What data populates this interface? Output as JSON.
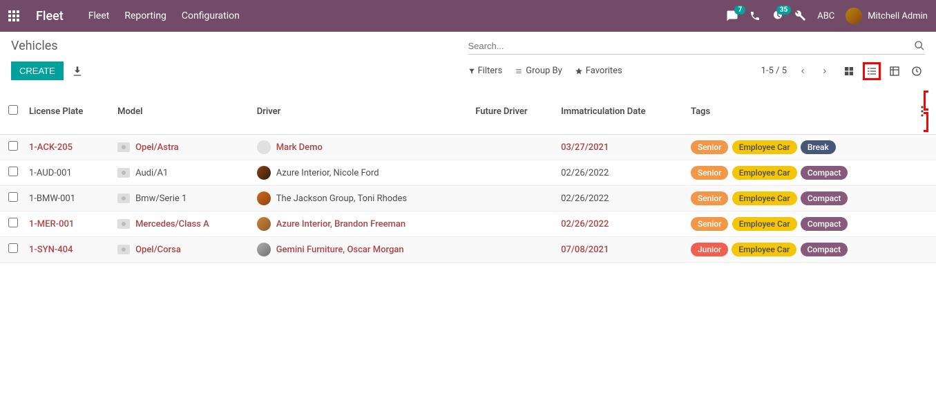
{
  "nav": {
    "brand": "Fleet",
    "menu": [
      "Fleet",
      "Reporting",
      "Configuration"
    ],
    "messages_badge": "7",
    "activities_badge": "35",
    "company": "ABC",
    "user": "Mitchell Admin"
  },
  "breadcrumb": "Vehicles",
  "buttons": {
    "create": "CREATE"
  },
  "search": {
    "placeholder": "Search..."
  },
  "filters": {
    "filters": "Filters",
    "groupby": "Group By",
    "favorites": "Favorites"
  },
  "pager": "1-5 / 5",
  "columns": {
    "license": "License Plate",
    "model": "Model",
    "driver": "Driver",
    "future": "Future Driver",
    "immat": "Immatriculation Date",
    "tags": "Tags"
  },
  "rows": [
    {
      "license": "1-ACK-205",
      "model": "Opel/Astra",
      "driver": "Mark Demo",
      "future": "",
      "immat": "03/27/2021",
      "tags": [
        {
          "t": "Senior",
          "c": "tag-senior"
        },
        {
          "t": "Employee Car",
          "c": "tag-employee"
        },
        {
          "t": "Break",
          "c": "tag-break"
        }
      ],
      "unread": true,
      "avatar_bg": "#e0e0e0"
    },
    {
      "license": "1-AUD-001",
      "model": "Audi/A1",
      "driver": "Azure Interior, Nicole Ford",
      "future": "",
      "immat": "02/26/2022",
      "tags": [
        {
          "t": "Senior",
          "c": "tag-senior"
        },
        {
          "t": "Employee Car",
          "c": "tag-employee"
        },
        {
          "t": "Compact",
          "c": "tag-compact"
        }
      ],
      "unread": false,
      "avatar_bg": "linear-gradient(135deg,#8b4513,#2f1b0c)"
    },
    {
      "license": "1-BMW-001",
      "model": "Bmw/Serie 1",
      "driver": "The Jackson Group, Toni Rhodes",
      "future": "",
      "immat": "02/26/2022",
      "tags": [
        {
          "t": "Senior",
          "c": "tag-senior"
        },
        {
          "t": "Employee Car",
          "c": "tag-employee"
        },
        {
          "t": "Compact",
          "c": "tag-compact"
        }
      ],
      "unread": false,
      "avatar_bg": "linear-gradient(135deg,#d2691e,#8b4513)"
    },
    {
      "license": "1-MER-001",
      "model": "Mercedes/Class A",
      "driver": "Azure Interior, Brandon Freeman",
      "future": "",
      "immat": "02/26/2022",
      "tags": [
        {
          "t": "Senior",
          "c": "tag-senior"
        },
        {
          "t": "Employee Car",
          "c": "tag-employee"
        },
        {
          "t": "Compact",
          "c": "tag-compact"
        }
      ],
      "unread": true,
      "avatar_bg": "linear-gradient(135deg,#cd853f,#8b5a2b)"
    },
    {
      "license": "1-SYN-404",
      "model": "Opel/Corsa",
      "driver": "Gemini Furniture, Oscar Morgan",
      "future": "",
      "immat": "07/08/2021",
      "tags": [
        {
          "t": "Junior",
          "c": "tag-junior"
        },
        {
          "t": "Employee Car",
          "c": "tag-employee"
        },
        {
          "t": "Compact",
          "c": "tag-compact"
        }
      ],
      "unread": true,
      "avatar_bg": "linear-gradient(135deg,#b0b0b0,#707070)"
    }
  ]
}
